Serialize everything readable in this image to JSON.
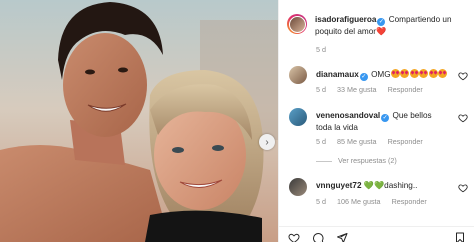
{
  "post": {
    "author": "isadorafigueroa",
    "caption": "Compartiendo un poquito del amor",
    "caption_emoji": "❤️",
    "age": "5 d"
  },
  "comments": [
    {
      "username": "dianamaux",
      "verified": true,
      "text": "OMG",
      "emoji_count": 6,
      "emoji": "heart-eyes-emoji",
      "age": "5 d",
      "likes": "33 Me gusta",
      "reply": "Responder"
    },
    {
      "username": "venenosandoval",
      "verified": true,
      "text": "Que bellos toda la vida",
      "age": "5 d",
      "likes": "85 Me gusta",
      "reply": "Responder",
      "view_replies": "Ver respuestas (2)"
    },
    {
      "username": "vnnguyet72",
      "verified": false,
      "emoji": "green-heart-emoji",
      "emoji_glyph": "💚💚",
      "text": "dashing..",
      "age": "5 d",
      "likes": "106 Me gusta",
      "reply": "Responder"
    }
  ],
  "icons": {
    "like": "heart-icon",
    "comment": "comment-icon",
    "share": "paper-plane-icon",
    "save": "bookmark-icon",
    "next": "chevron-right-icon",
    "verified": "verified-badge-icon"
  },
  "colors": {
    "verified_blue": "#3897f0",
    "meta_gray": "#8e8e8e",
    "text": "#262626",
    "heart_red": "#e0245e",
    "green_heart": "#36c13e"
  }
}
